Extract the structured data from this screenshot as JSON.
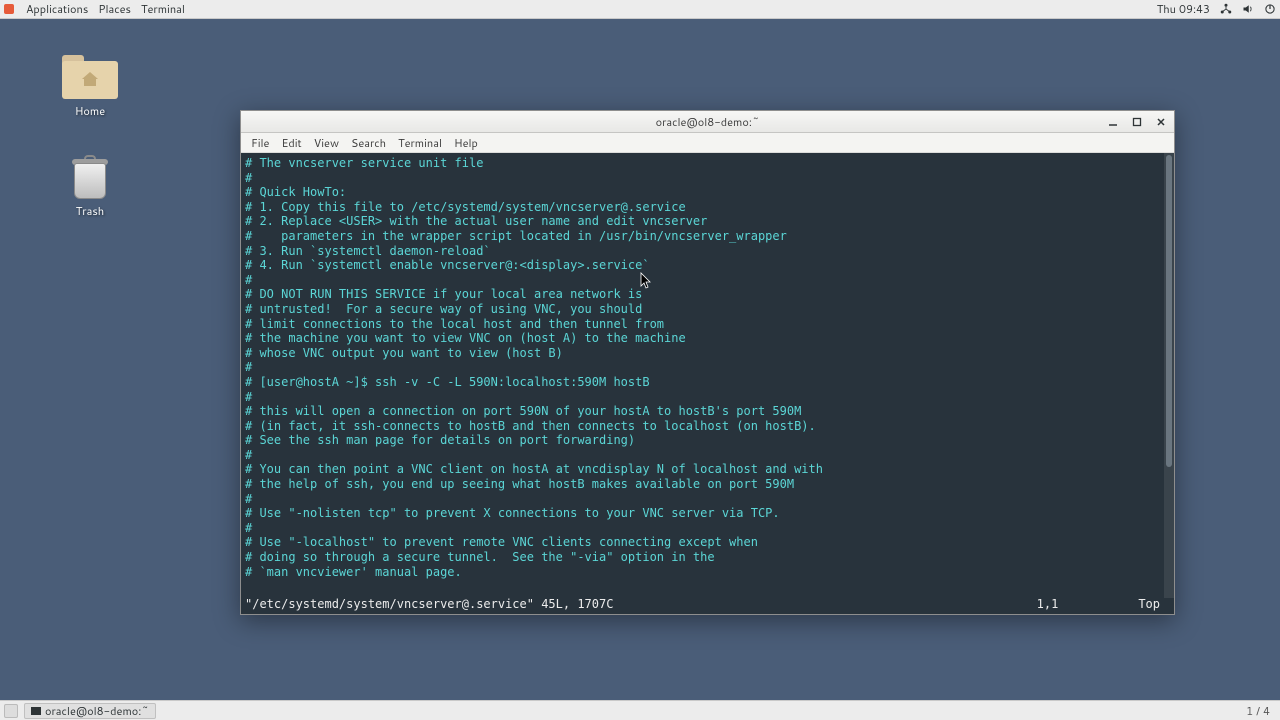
{
  "panel": {
    "menus": [
      "Applications",
      "Places",
      "Terminal"
    ],
    "clock": "Thu 09:43"
  },
  "desktop": {
    "home_label": "Home",
    "trash_label": "Trash"
  },
  "window": {
    "title": "oracle@ol8-demo:~",
    "menus": [
      "File",
      "Edit",
      "View",
      "Search",
      "Terminal",
      "Help"
    ]
  },
  "vim": {
    "lines": [
      "# The vncserver service unit file",
      "#",
      "# Quick HowTo:",
      "# 1. Copy this file to /etc/systemd/system/vncserver@.service",
      "# 2. Replace <USER> with the actual user name and edit vncserver",
      "#    parameters in the wrapper script located in /usr/bin/vncserver_wrapper",
      "# 3. Run `systemctl daemon-reload`",
      "# 4. Run `systemctl enable vncserver@:<display>.service`",
      "#",
      "# DO NOT RUN THIS SERVICE if your local area network is",
      "# untrusted!  For a secure way of using VNC, you should",
      "# limit connections to the local host and then tunnel from",
      "# the machine you want to view VNC on (host A) to the machine",
      "# whose VNC output you want to view (host B)",
      "#",
      "# [user@hostA ~]$ ssh -v -C -L 590N:localhost:590M hostB",
      "#",
      "# this will open a connection on port 590N of your hostA to hostB's port 590M",
      "# (in fact, it ssh-connects to hostB and then connects to localhost (on hostB).",
      "# See the ssh man page for details on port forwarding)",
      "#",
      "# You can then point a VNC client on hostA at vncdisplay N of localhost and with",
      "# the help of ssh, you end up seeing what hostB makes available on port 590M",
      "#",
      "# Use \"-nolisten tcp\" to prevent X connections to your VNC server via TCP.",
      "#",
      "# Use \"-localhost\" to prevent remote VNC clients connecting except when",
      "# doing so through a secure tunnel.  See the \"-via\" option in the",
      "# `man vncviewer' manual page.",
      ""
    ],
    "status_file": "\"/etc/systemd/system/vncserver@.service\" 45L, 1707C",
    "status_cursor": "1,1",
    "status_pos": "Top"
  },
  "taskbar": {
    "task_label": "oracle@ol8-demo:~",
    "workspace": "1 / 4"
  }
}
